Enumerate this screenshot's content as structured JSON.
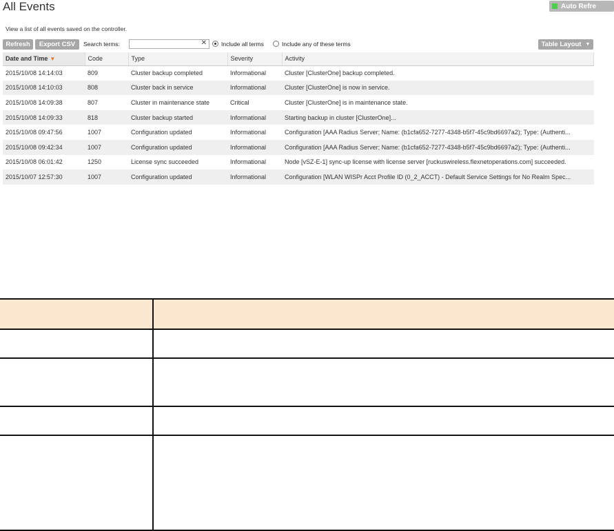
{
  "header": {
    "title": "All Events",
    "auto_refresh_label": "Auto Refre",
    "auto_refresh_dot_color": "#4cd04c",
    "subtitle": "View a list of all events saved on the controller."
  },
  "toolbar": {
    "refresh_label": "Refresh",
    "export_label": "Export CSV",
    "search_label": "Search terms:",
    "search_value": "",
    "radio_all_label": "Include all terms",
    "radio_any_label": "Include any of these terms",
    "table_layout_label": "Table Layout"
  },
  "table": {
    "columns": [
      "Date and Time",
      "Code",
      "Type",
      "Severity",
      "Activity"
    ],
    "rows": [
      [
        "2015/10/08 14:14:03",
        "809",
        "Cluster backup completed",
        "Informational",
        "Cluster [ClusterOne] backup completed."
      ],
      [
        "2015/10/08 14:10:03",
        "808",
        "Cluster back in service",
        "Informational",
        "Cluster [ClusterOne] is now in service."
      ],
      [
        "2015/10/08 14:09:38",
        "807",
        "Cluster in maintenance state",
        "Critical",
        "Cluster [ClusterOne] is in maintenance state."
      ],
      [
        "2015/10/08 14:09:33",
        "818",
        "Cluster backup started",
        "Informational",
        "Starting backup in cluster [ClusterOne]..."
      ],
      [
        "2015/10/08 09:47:56",
        "1007",
        "Configuration updated",
        "Informational",
        "Configuration [AAA Radius Server; Name: (b1cfa652-7277-4348-b5f7-45c9bd6697a2); Type: (Authenti..."
      ],
      [
        "2015/10/08 09:42:34",
        "1007",
        "Configuration updated",
        "Informational",
        "Configuration [AAA Radius Server; Name: (b1cfa652-7277-4348-b5f7-45c9bd6697a2); Type: (Authenti..."
      ],
      [
        "2015/10/08 06:01:42",
        "1250",
        "License sync succeeded",
        "Informational",
        "Node [vSZ-E-1] sync-up license with license server [ruckuswireless.flexnetoperations.com] succeeded."
      ],
      [
        "2015/10/07 12:57:30",
        "1007",
        "Configuration updated",
        "Informational",
        "Configuration [WLAN WISPr Acct Profile ID (0_2_ACCT) - Default Service Settings for No Realm Spec..."
      ]
    ]
  }
}
